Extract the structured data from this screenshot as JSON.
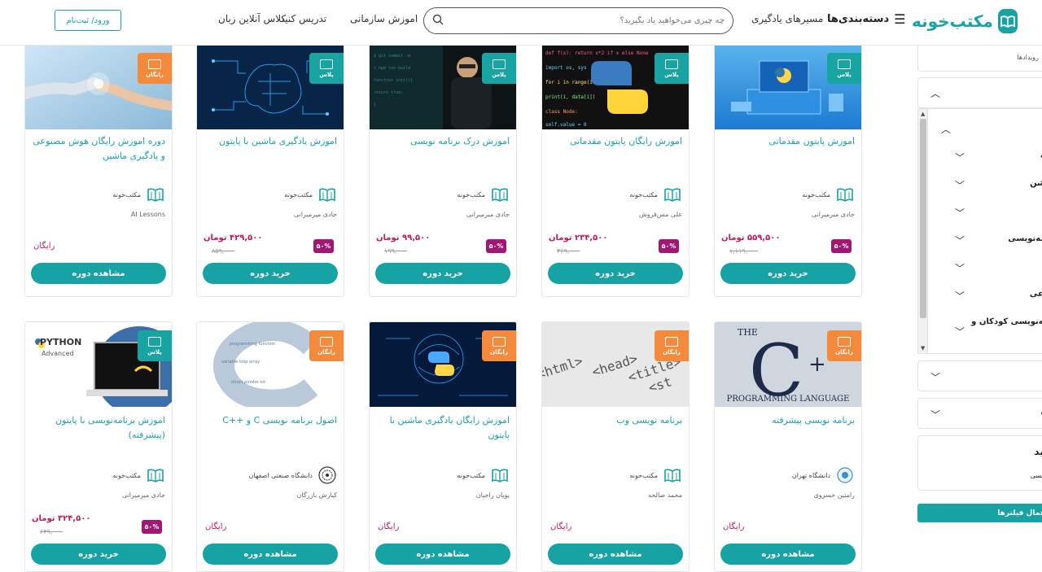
{
  "header": {
    "logo_text": "مکتب‌خونه",
    "categories_label": "دسته‌بندی‌ها",
    "nav": [
      {
        "label": "مسیرهای یادگیری"
      },
      {
        "label": "اموزش سازمانی"
      },
      {
        "label": "تدریس کنید"
      },
      {
        "label": "کلاس آنلاین زبان"
      }
    ],
    "search_placeholder": "چه چیزی می‌خواهید یاد بگیرید؟",
    "login_label": "ورود/ ثبت‌نام"
  },
  "sidebar": {
    "top_text": "رویدادها",
    "items": [
      {
        "label": "ت"
      },
      {
        "label": "یشن"
      },
      {
        "label": ""
      },
      {
        "label": "امه‌نویسی"
      },
      {
        "label": ""
      },
      {
        "label": "وعی"
      },
      {
        "label": "مه‌نویسی کودکان و"
      }
    ],
    "box2_text": "اه",
    "box3_title": "دید",
    "box3_sub": "نویسی",
    "apply_label": "اعمال فیلترها"
  },
  "cards": [
    {
      "title": "اموزش پایتون مقدماتی",
      "badge": "پلاس",
      "badge_type": "plus",
      "org": "مکتب‌خونه",
      "teacher": "جادی میرمیرانی",
      "price": "۵۵۹,۵۰۰ تومان",
      "old_price": "۱,۱۱۹,۰۰۰",
      "discount": "۵۰%",
      "cta": "خرید دوره",
      "free": "",
      "img": "python-laptop",
      "org_logo": "maktab"
    },
    {
      "title": "اموزش رایگان پایتون مقدماتی",
      "badge": "پلاس",
      "badge_type": "plus",
      "org": "مکتب‌خونه",
      "teacher": "علی مس‌فروش",
      "price": "۲۳۴,۵۰۰ تومان",
      "old_price": "۴۶۹,۰۰۰",
      "discount": "۵۰%",
      "cta": "خرید دوره",
      "free": "",
      "img": "python-code",
      "org_logo": "maktab"
    },
    {
      "title": "اموزش درک برنامه نویسی",
      "badge": "پلاس",
      "badge_type": "plus",
      "org": "مکتب‌خونه",
      "teacher": "جادی میرمیرانی",
      "price": "۹۹,۵۰۰ تومان",
      "old_price": "۱۹۹,۰۰۰",
      "discount": "۵۰%",
      "cta": "خرید دوره",
      "free": "",
      "img": "programmer",
      "org_logo": "maktab"
    },
    {
      "title": "اموزش یادگیری ماشین با پایتون",
      "badge": "پلاس",
      "badge_type": "plus",
      "org": "مکتب‌خونه",
      "teacher": "جادی میرمیرانی",
      "price": "۴۲۹,۵۰۰ تومان",
      "old_price": "۸۵۹,۰۰۰",
      "discount": "۵۰%",
      "cta": "خرید دوره",
      "free": "",
      "img": "brain-circuit",
      "org_logo": "maktab"
    },
    {
      "title": "دوره اموزش رایگان هوش مصنوعی و یادگیری ماشین",
      "badge": "رایگان",
      "badge_type": "free",
      "org": "مکتب‌خونه",
      "teacher": "AI Lessons",
      "price": "",
      "old_price": "",
      "discount": "",
      "cta": "مشاهده دوره",
      "free": "رایگان",
      "img": "robot-hand",
      "org_logo": "maktab"
    },
    {
      "title": "برنامه نویسی پیشرفته",
      "badge": "رایگان",
      "badge_type": "free",
      "org": "دانشگاه تهران",
      "teacher": "رامتین خسروی",
      "price": "",
      "old_price": "",
      "discount": "",
      "cta": "مشاهده دوره",
      "free": "رایگان",
      "img": "cpp-book",
      "org_logo": "tehran",
      "img_text": "PROGRAMMING LANGUAGE"
    },
    {
      "title": "برنامه نویسی وب",
      "badge": "رایگان",
      "badge_type": "free",
      "org": "مکتب‌خونه",
      "teacher": "محمد صالحه",
      "price": "",
      "old_price": "",
      "discount": "",
      "cta": "مشاهده دوره",
      "free": "رایگان",
      "img": "html-tags",
      "org_logo": "maktab"
    },
    {
      "title": "اموزش رایگان یادگیری ماشین با پایتون",
      "badge": "رایگان",
      "badge_type": "free",
      "org": "مکتب‌خونه",
      "teacher": "پویان راجیان",
      "price": "",
      "old_price": "",
      "discount": "",
      "cta": "مشاهده دوره",
      "free": "رایگان",
      "img": "python-brain",
      "org_logo": "maktab"
    },
    {
      "title": "اصول برنامه نویسی C و ++C",
      "badge": "رایگان",
      "badge_type": "free",
      "org": "دانشگاه صنعتی اصفهان",
      "teacher": "کیارش بازرگان",
      "price": "",
      "old_price": "",
      "discount": "",
      "cta": "مشاهده دوره",
      "free": "رایگان",
      "img": "c-wordcloud",
      "org_logo": "isfahan"
    },
    {
      "title": "اموزش برنامه‌نویسی با پایتون (پیشرفته)",
      "badge": "پلاس",
      "badge_type": "plus",
      "org": "مکتب‌خونه",
      "teacher": "جادی میرمیرانی",
      "price": "۳۲۴,۵۰۰ تومان",
      "old_price": "۶۴۹,۰۰۰",
      "discount": "۵۰%",
      "cta": "خرید دوره",
      "free": "",
      "img": "python-advanced",
      "org_logo": "maktab",
      "img_text": "PYTHON",
      "img_subtext": "Advanced"
    }
  ],
  "colors": {
    "accent": "#17a2a4",
    "plus_badge": "#18a4a3",
    "free_badge": "#f38a3c",
    "price": "#c2185b",
    "discount": "#a01874"
  }
}
